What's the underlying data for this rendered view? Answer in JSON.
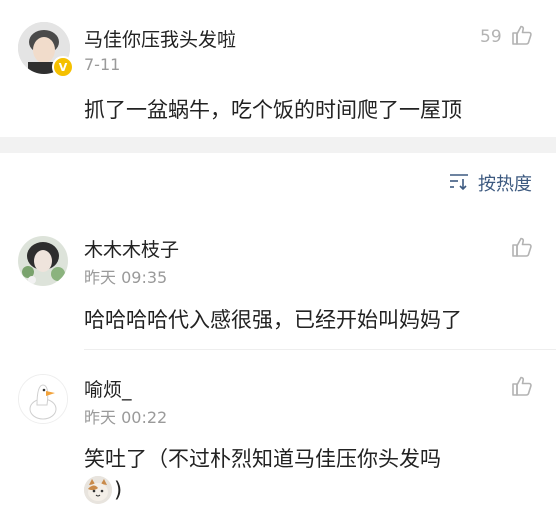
{
  "top_comment": {
    "user": "马佳你压我头发啦",
    "date": "7-11",
    "likes": "59",
    "text": "抓了一盆蜗牛，吃个饭的时间爬了一屋顶"
  },
  "sort": {
    "label": "按热度"
  },
  "replies": [
    {
      "user": "木木木枝子",
      "date": "昨天 09:35",
      "text": "哈哈哈哈代入感很强，已经开始叫妈妈了"
    },
    {
      "user": "喻烦_",
      "date": "昨天 00:22",
      "text": "笑吐了（不过朴烈知道马佳压你头发吗",
      "text2": ")"
    }
  ],
  "colors": {
    "link_blue": "#3d5a80",
    "muted": "#9a9a9a",
    "section_gap": "#f2f2f2",
    "verified_badge": "#f5c000"
  },
  "icons": [
    "thumbs-up-icon",
    "sort-lines-icon",
    "verified-badge-icon",
    "cat-emoji-icon"
  ]
}
